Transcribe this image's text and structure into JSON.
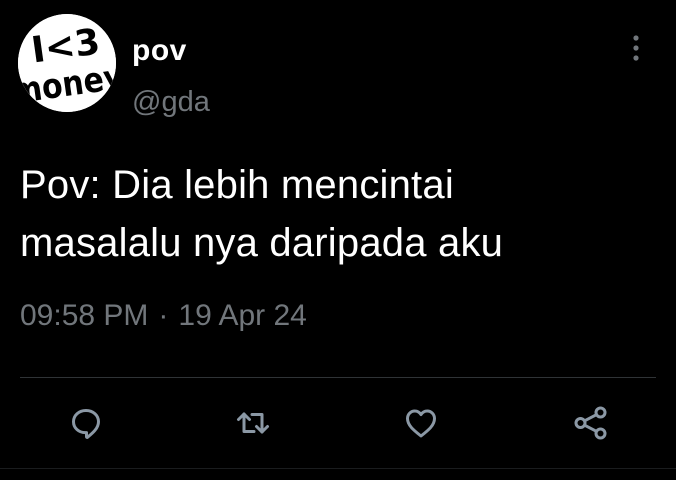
{
  "author": {
    "display_name": "pov",
    "handle": "@gda",
    "avatar_text": [
      "I<3",
      "money"
    ]
  },
  "tweet": {
    "text_line1": "Pov: Dia lebih mencintai",
    "text_line2": "masalalu nya daripada aku",
    "time": "09:58 PM",
    "separator": "·",
    "date": "19 Apr 24"
  },
  "actions": [
    "reply-icon",
    "retweet-icon",
    "like-icon",
    "share-icon"
  ],
  "colors": {
    "background": "#000000",
    "text": "#ffffff",
    "secondary": "#71767b",
    "divider": "#2f3336"
  }
}
